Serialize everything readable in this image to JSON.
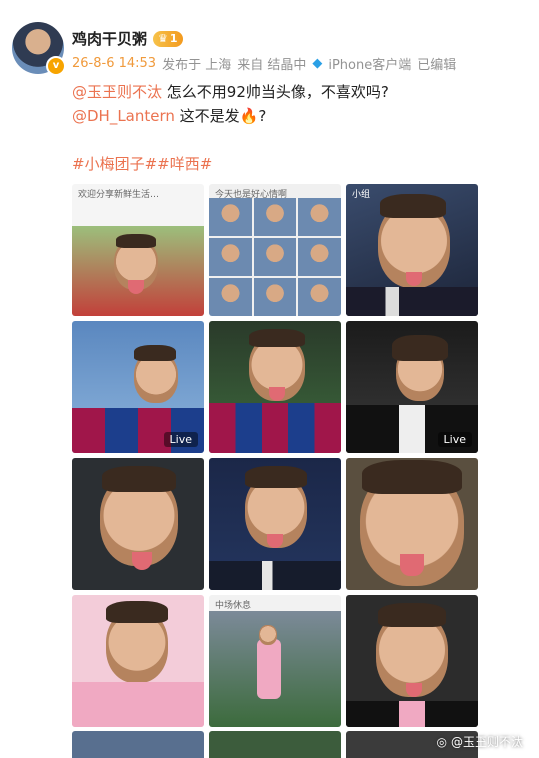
{
  "post": {
    "username": "鸡肉干贝粥",
    "level_badge": "1",
    "meta": {
      "time": "26-8-6 14:53",
      "location": "发布于 上海",
      "source_prefix": "来自 结晶中",
      "source_suffix": "iPhone客户端",
      "edited": "已编辑"
    },
    "lines": [
      {
        "mention": "@玉玊则不汰",
        "text": " 怎么不用92帅当头像，不喜欢吗?"
      },
      {
        "mention": "@DH_Lantern",
        "text": " 这不是发",
        "emoji": "🔥",
        "after": "?"
      }
    ],
    "topics": "#小梅团子##咩西#"
  },
  "images": [
    {
      "live": "",
      "label": "collage-screenshot",
      "mini": "欢迎分享新鲜生活…"
    },
    {
      "live": "",
      "label": "collage-grid",
      "mini": "今天也是好心情啊"
    },
    {
      "live": "",
      "label": "messi-tongue-1",
      "mini": "小组"
    },
    {
      "live": "Live",
      "label": "barca-dugout"
    },
    {
      "live": "",
      "label": "barca-thumbs-up"
    },
    {
      "live": "Live",
      "label": "tuxedo"
    },
    {
      "live": "",
      "label": "messi-tongue-2"
    },
    {
      "live": "",
      "label": "psg-suit"
    },
    {
      "live": "",
      "label": "messi-close-up"
    },
    {
      "live": "",
      "label": "inter-miami-pink"
    },
    {
      "live": "",
      "label": "stadium-celebration",
      "mini": "中场休息"
    },
    {
      "live": "",
      "label": "inter-miami-black"
    }
  ],
  "watermark": "@玉玊则不汰"
}
